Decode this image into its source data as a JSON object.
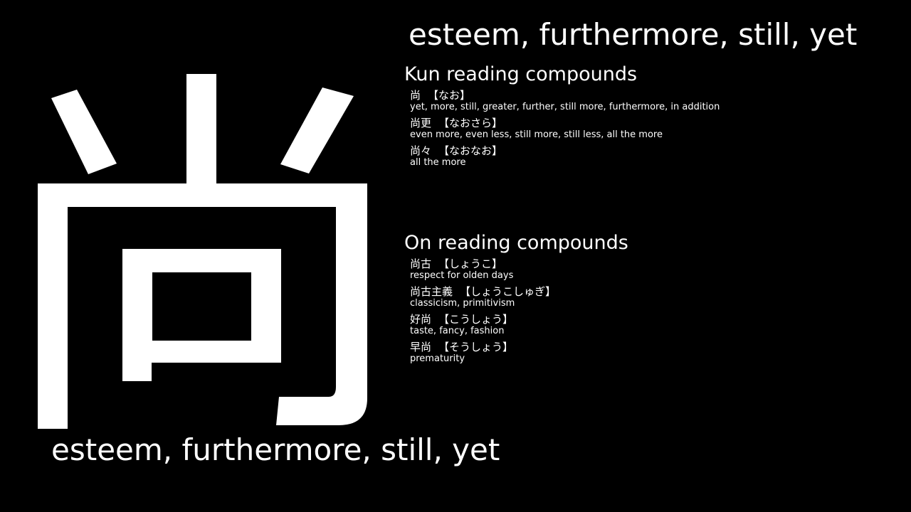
{
  "kanji": {
    "character": "尚",
    "color": "#ffffff"
  },
  "meaning_top": "esteem, furthermore, still, yet",
  "meaning_bottom": "esteem, furthermore, still, yet",
  "kun": {
    "title": "Kun reading compounds",
    "compounds": [
      {
        "word": "尚",
        "reading": "【なお】",
        "gloss": "yet, more, still, greater, further, still more, furthermore, in addition"
      },
      {
        "word": "尚更",
        "reading": "【なおさら】",
        "gloss": "even more, even less, still more, still less, all the more"
      },
      {
        "word": "尚々",
        "reading": "【なおなお】",
        "gloss": "all the more"
      }
    ]
  },
  "on": {
    "title": "On reading compounds",
    "compounds": [
      {
        "word": "尚古",
        "reading": "【しょうこ】",
        "gloss": "respect for olden days"
      },
      {
        "word": "尚古主義",
        "reading": "【しょうこしゅぎ】",
        "gloss": "classicism, primitivism"
      },
      {
        "word": "好尚",
        "reading": "【こうしょう】",
        "gloss": "taste, fancy, fashion"
      },
      {
        "word": "早尚",
        "reading": "【そうしょう】",
        "gloss": "prematurity"
      }
    ]
  },
  "colors": {
    "background": "#000000",
    "text": "#ffffff"
  }
}
